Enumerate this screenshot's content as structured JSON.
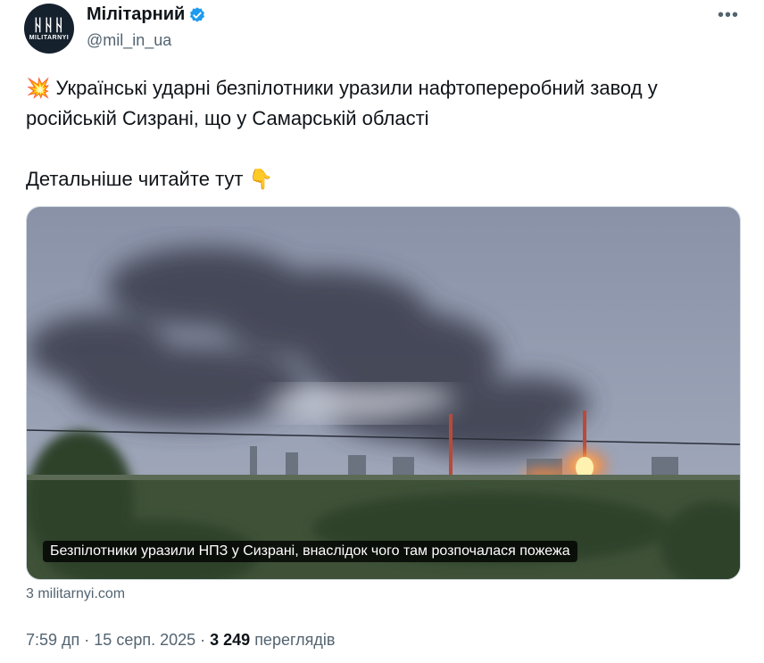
{
  "author": {
    "display_name": "Мілітарний",
    "handle": "@mil_in_ua",
    "avatar_glyph": "ᚺᚺᚺ",
    "avatar_brand": "MILITARNYI"
  },
  "tweet": {
    "emoji_boom": "💥",
    "line1": "Українські ударні безпілотники уразили нафтопереробний завод у російській Сизрані, що у Самарській області",
    "line2": "Детальніше читайте тут",
    "emoji_point": "👇"
  },
  "media": {
    "caption": "Безпілотники уразили НПЗ у Сизрані, внаслідок чого там розпочалася пожежа"
  },
  "source": "3 militarnyi.com",
  "meta": {
    "time": "7:59 дп",
    "sep1": " · ",
    "date": "15 серп. 2025",
    "sep2": " · ",
    "views_count": "3 249",
    "views_label": " переглядів"
  },
  "colors": {
    "verified": "#1d9bf0",
    "muted": "#536471",
    "fire": "#ff7a2a"
  }
}
